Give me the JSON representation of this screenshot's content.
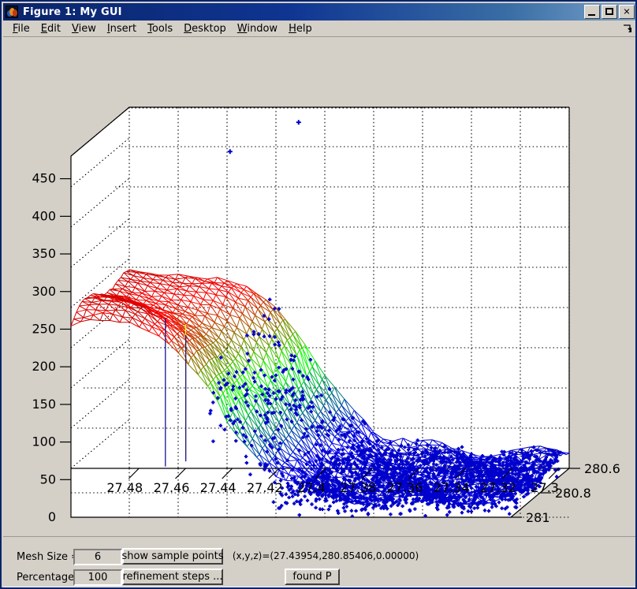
{
  "window": {
    "title": "Figure 1: My GUI",
    "icon": "matlab-membrane-icon",
    "buttons": {
      "minimize": "_",
      "maximize": "□",
      "close": "✕"
    }
  },
  "menubar": {
    "items": [
      {
        "mnemonic": "F",
        "rest": "ile"
      },
      {
        "mnemonic": "E",
        "rest": "dit"
      },
      {
        "mnemonic": "V",
        "rest": "iew"
      },
      {
        "mnemonic": "I",
        "rest": "nsert"
      },
      {
        "mnemonic": "T",
        "rest": "ools"
      },
      {
        "mnemonic": "D",
        "rest": "esktop"
      },
      {
        "mnemonic": "W",
        "rest": "indow"
      },
      {
        "mnemonic": "H",
        "rest": "elp"
      }
    ],
    "overflow_icon": "menu-expand-arrow-icon"
  },
  "controls": {
    "mesh_size_label": "Mesh Size =",
    "mesh_size_value": "6",
    "percentage_label": "Percentage",
    "percentage_value": "100",
    "show_sample_points_label": "show sample points",
    "refinement_steps_label": "refinement steps ...",
    "coordinate_readout": "(x,y,z)=(27.43954,280.85406,0.00000)",
    "found_p_label": "found P"
  },
  "chart_data": {
    "type": "surface",
    "title": "",
    "xlabel": "",
    "ylabel": "",
    "zlabel": "",
    "grid": true,
    "legend": false,
    "colormap": "jet",
    "projection": "3d-axes-box",
    "figure_background": "#d4d0c8",
    "axes_background": "#ffffff",
    "grid_color": "#000000",
    "grid_style": "dotted",
    "marker_color": "#0000cc",
    "marker_symbol": "+",
    "x_axis": {
      "label": "",
      "ticks": [
        "27.48",
        "27.46",
        "27.44",
        "27.42",
        "27.4",
        "27.38",
        "27.36",
        "27.34",
        "27.32",
        "27.3"
      ],
      "values": [
        27.48,
        27.46,
        27.44,
        27.42,
        27.4,
        27.38,
        27.36,
        27.34,
        27.32,
        27.3
      ],
      "min": 27.49,
      "max": 27.29,
      "direction": "reversed"
    },
    "y_axis": {
      "label": "",
      "ticks": [
        "280.6",
        "280.8",
        "281"
      ],
      "values": [
        280.6,
        280.8,
        281.0
      ],
      "min": 280.55,
      "max": 281.05
    },
    "z_axis": {
      "label": "",
      "ticks": [
        "0",
        "50",
        "100",
        "150",
        "200",
        "250",
        "300",
        "350",
        "400",
        "450"
      ],
      "values": [
        0,
        50,
        100,
        150,
        200,
        250,
        300,
        350,
        400,
        450
      ],
      "min": 0,
      "max": 480
    },
    "series": [
      {
        "name": "surface-mesh",
        "kind": "wireframe-surface",
        "description": "Triangulated jet-colormap wireframe: high dark-red/red plateau near z=230-290 over the high-x region, steep descent through orange, yellow, green and cyan, flattening to a broad blue sheet near z=0-40 over the low-x region.",
        "plateau_z_range": [
          225,
          290
        ],
        "falloff_z_range": [
          20,
          230
        ],
        "floor_z_range": [
          0,
          45
        ],
        "spike_count": 3,
        "spike_min_z": 45
      },
      {
        "name": "sample-points",
        "kind": "scatter3",
        "color": "#0000cc",
        "marker": "+",
        "description": "Dense cloud of blue plus-markers clustered on the descending flank and across the low-z blue floor, with two isolated high outliers.",
        "outliers": [
          {
            "x": 27.404,
            "y": 280.72,
            "z": 482
          },
          {
            "x": 27.432,
            "y": 280.78,
            "z": 451
          }
        ]
      }
    ]
  }
}
